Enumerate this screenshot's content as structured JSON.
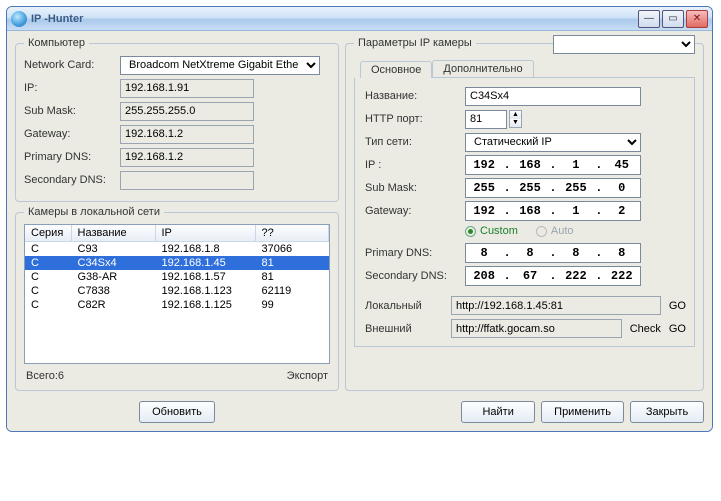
{
  "title": "IP  -Hunter",
  "computer": {
    "legend": "Компьютер",
    "labels": {
      "nc": "Network Card:",
      "ip": "IP:",
      "mask": "Sub Mask:",
      "gw": "Gateway:",
      "pdns": "Primary DNS:",
      "sdns": "Secondary DNS:"
    },
    "nc": "Broadcom NetXtreme Gigabit Ethe",
    "ip": "192.168.1.91",
    "mask": "255.255.255.0",
    "gw": "192.168.1.2",
    "pdns": "192.168.1.2",
    "sdns": ""
  },
  "localcams": {
    "legend": "Камеры в локальной сети",
    "cols": {
      "series": "Серия",
      "name": "Название",
      "ip": "IP",
      "qq": "??"
    },
    "rows": [
      {
        "series": "C",
        "name": "C93",
        "ip": "192.168.1.8",
        "qq": "37066"
      },
      {
        "series": "C",
        "name": "C34Sx4",
        "ip": "192.168.1.45",
        "qq": "81"
      },
      {
        "series": "C",
        "name": "G38-AR",
        "ip": "192.168.1.57",
        "qq": "81"
      },
      {
        "series": "C",
        "name": "C7838",
        "ip": "192.168.1.123",
        "qq": "62119"
      },
      {
        "series": "C",
        "name": "C82R",
        "ip": "192.168.1.125",
        "qq": "99"
      }
    ],
    "total_label": "Всего:6",
    "export": "Экспорт",
    "refresh": "Обновить"
  },
  "params": {
    "legend": "Параметры IP камеры",
    "tabs": {
      "main": "Основное",
      "adv": "Дополнительно"
    },
    "labels": {
      "name": "Название:",
      "http": "HTTP порт:",
      "nettype": "Тип сети:",
      "ip": "IP :",
      "mask": "Sub Mask:",
      "gw": "Gateway:",
      "custom": "Custom",
      "auto": "Auto",
      "pdns": "Primary DNS:",
      "sdns": "Secondary DNS:",
      "local": "Локальный",
      "external": "Внешний",
      "go": "GO",
      "check": "Check"
    },
    "name": "C34Sx4",
    "http": "81",
    "nettype": "Статический IP",
    "ip": [
      "192",
      "168",
      "1",
      "45"
    ],
    "mask": [
      "255",
      "255",
      "255",
      "0"
    ],
    "gw": [
      "192",
      "168",
      "1",
      "2"
    ],
    "pdns": [
      "8",
      "8",
      "8",
      "8"
    ],
    "sdns": [
      "208",
      "67",
      "222",
      "222"
    ],
    "local_url": "http://192.168.1.45:81",
    "external_url": "http://ffatk.gocam.so"
  },
  "buttons": {
    "find": "Найти",
    "apply": "Применить",
    "close": "Закрыть"
  }
}
